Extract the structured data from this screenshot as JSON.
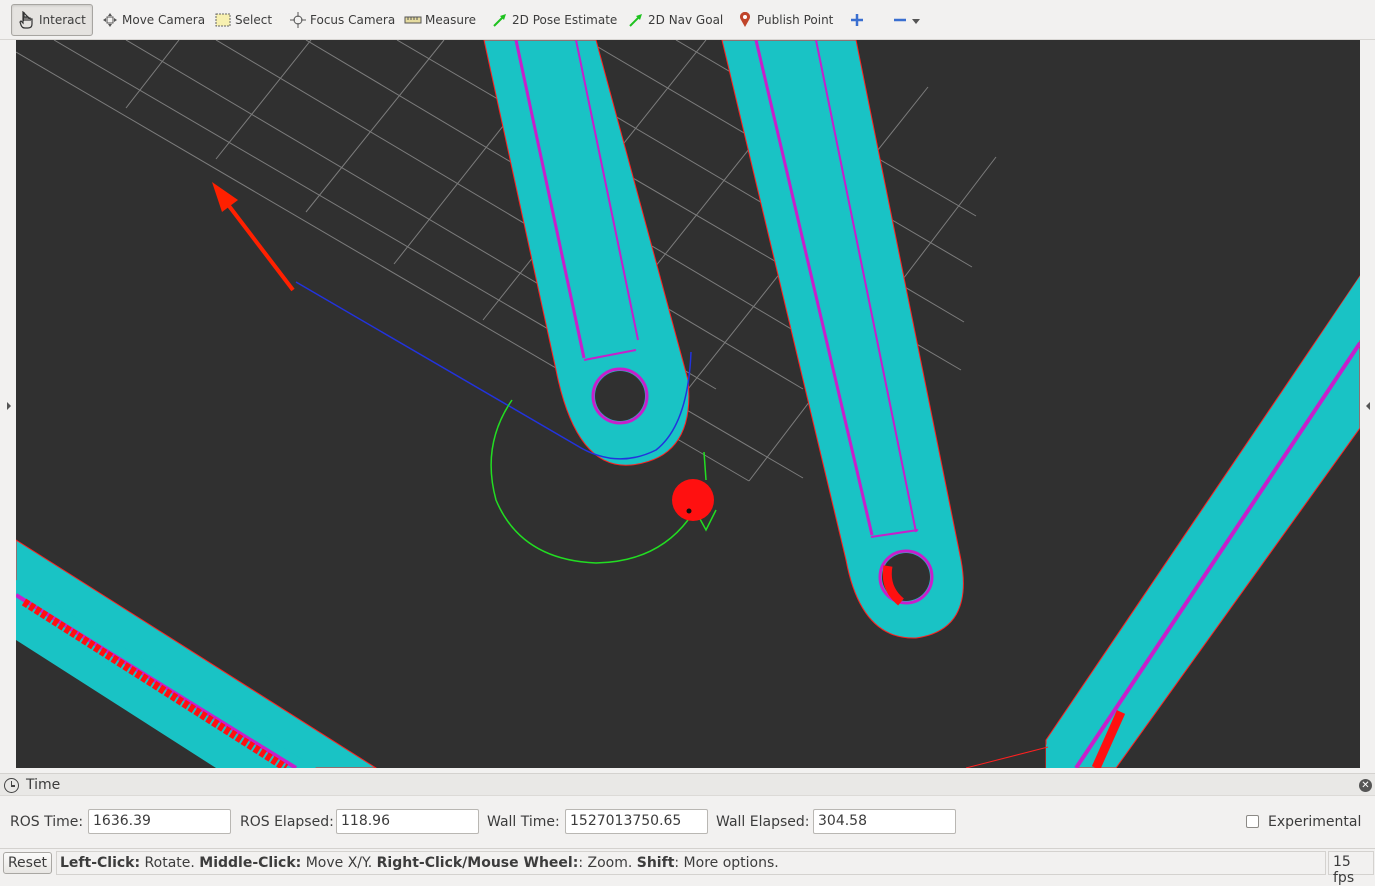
{
  "toolbar": {
    "tools": [
      {
        "label": "Interact",
        "icon": "hand-pointer-icon"
      },
      {
        "label": "Move Camera",
        "icon": "move-camera-icon"
      },
      {
        "label": "Select",
        "icon": "select-rectangle-icon"
      },
      {
        "label": "Focus Camera",
        "icon": "focus-crosshair-icon"
      },
      {
        "label": "Measure",
        "icon": "ruler-icon"
      },
      {
        "label": "2D Pose Estimate",
        "icon": "green-arrow-icon"
      },
      {
        "label": "2D Nav Goal",
        "icon": "green-arrow-icon"
      },
      {
        "label": "Publish Point",
        "icon": "map-pin-icon"
      }
    ],
    "add_icon": "plus-icon",
    "remove_icon": "minus-icon"
  },
  "time_panel": {
    "title": "Time",
    "ros_time_label": "ROS Time:",
    "ros_time_value": "1636.39",
    "ros_elapsed_label": "ROS Elapsed:",
    "ros_elapsed_value": "118.96",
    "wall_time_label": "Wall Time:",
    "wall_time_value": "1527013750.65",
    "wall_elapsed_label": "Wall Elapsed:",
    "wall_elapsed_value": "304.58",
    "experimental_label": "Experimental"
  },
  "status_bar": {
    "reset_label": "Reset",
    "hint_parts": [
      {
        "bold": "Left-Click:",
        "text": " Rotate. "
      },
      {
        "bold": "Middle-Click:",
        "text": " Move X/Y. "
      },
      {
        "bold": "Right-Click/Mouse Wheel:",
        "text": ": Zoom. "
      },
      {
        "bold": "Shift",
        "text": ": More options."
      }
    ],
    "fps": "15 fps"
  },
  "colors": {
    "background": "#303030",
    "inflation": "#19c3c5",
    "obstacle": "#c71fcb",
    "lethal": "#ff0000",
    "grid": "#a0a0a0",
    "global_plan": "#2233dd",
    "local_plan": "#22dd22"
  }
}
